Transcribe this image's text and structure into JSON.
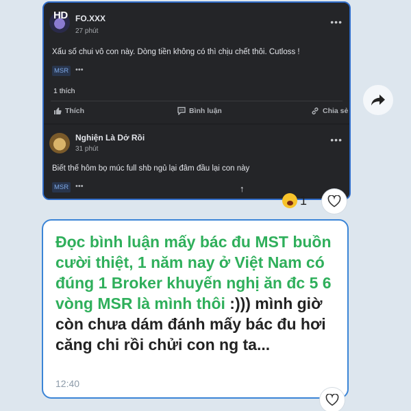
{
  "post1": {
    "avatar_label": "HD",
    "author": "FO.XXX",
    "time": "27 phút",
    "menu": "•••",
    "content": "Xấu số chui vô con này. Dòng tiền không có thì chịu chết thôi. Cutloss !",
    "tag": "MSR",
    "tag_more": "•••",
    "likes": "1 thích",
    "actions": {
      "like": "Thích",
      "comment": "Bình luận",
      "share": "Chia sẻ"
    }
  },
  "post2": {
    "author": "Nghiện Là Dở Rồi",
    "time": "31 phút",
    "menu": "•••",
    "content": "Biết thế hôm bọ múc full shb ngủ lại đâm đầu lại con này",
    "tag": "MSR",
    "tag_more": "•••",
    "scroll_up": "↑"
  },
  "reaction": {
    "count": "1",
    "emoji": "laughing-emoji"
  },
  "message": {
    "text_green": "Đọc bình luận mấy bác đu MST buồn cười thiệt, 1 năm nay ở Việt Nam có đúng 1 Broker khuyến nghị ăn đc 5 6 vòng MSR là mình thôi",
    "text_dark": " :))) mình giờ còn chưa dám đánh mấy bác đu hơi căng chi rồi chửi con ng ta...",
    "time": "12:40"
  },
  "colors": {
    "accent_green": "#2faf5b",
    "bubble_border": "#3a84d6",
    "background": "#dde6ee"
  }
}
